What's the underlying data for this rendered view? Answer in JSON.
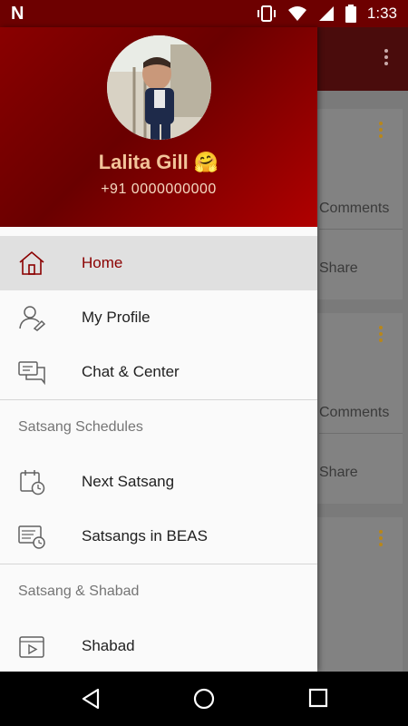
{
  "status_bar": {
    "time": "1:33",
    "notification_icon": "n-notification-icon",
    "icons": [
      "vibrate-icon",
      "wifi-icon",
      "signal-icon",
      "battery-icon"
    ]
  },
  "background": {
    "cards": [
      {
        "comments_label": "Comments",
        "share_label": "Share"
      },
      {
        "comments_label": "Comments",
        "share_label": "Share"
      },
      {}
    ]
  },
  "drawer": {
    "header": {
      "name": "Lalita Gill 🤗",
      "phone": "+91 0000000000"
    },
    "menu": [
      {
        "label": "Home",
        "icon": "home-icon",
        "active": true
      },
      {
        "label": "My Profile",
        "icon": "profile-icon"
      },
      {
        "label": "Chat & Center",
        "icon": "chat-icon"
      }
    ],
    "sections": [
      {
        "title": "Satsang Schedules",
        "items": [
          {
            "label": "Next Satsang",
            "icon": "calendar-clock-icon"
          },
          {
            "label": "Satsangs in BEAS",
            "icon": "schedule-list-icon"
          }
        ]
      },
      {
        "title": "Satsang & Shabad",
        "items": [
          {
            "label": "Shabad",
            "icon": "video-play-icon"
          }
        ]
      }
    ]
  },
  "colors": {
    "brand": "#8b0000",
    "active_bg": "#e0e0e0",
    "name_color": "#f2c49a",
    "accent_dots": "#b8871a"
  },
  "nav_bar": {
    "buttons": [
      "back-icon",
      "home-circle-icon",
      "recents-icon"
    ]
  }
}
